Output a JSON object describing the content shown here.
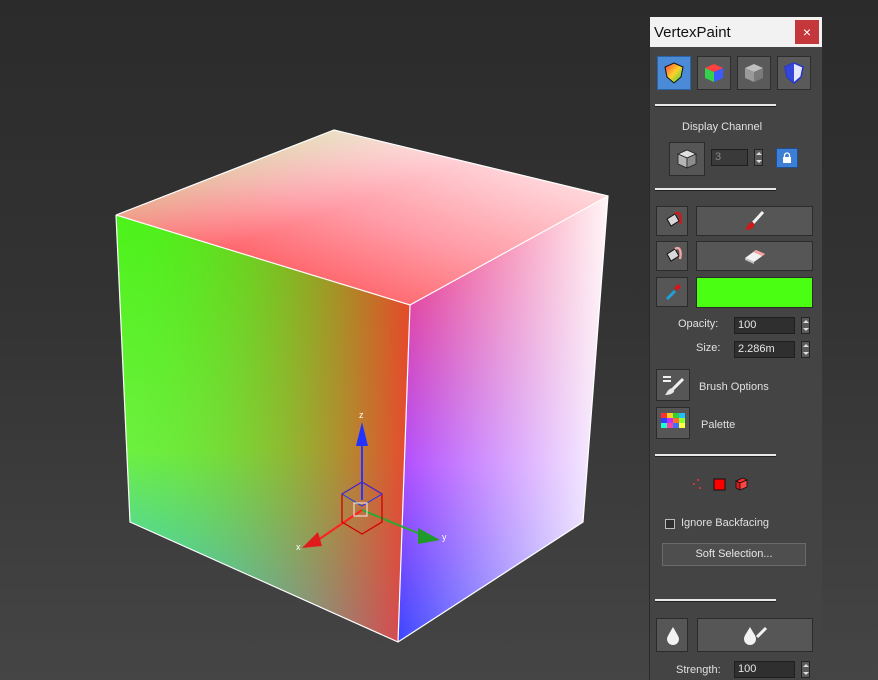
{
  "viewport": {
    "gizmo_axes": {
      "x": "x",
      "y": "y",
      "z": "z"
    }
  },
  "panel": {
    "title": "VertexPaint",
    "close_glyph": "×",
    "mode_icons": [
      "vertex-color-mode-icon",
      "vertex-color-display-icon",
      "shaded-display-icon",
      "shield-display-icon"
    ],
    "display_channel": {
      "label": "Display Channel",
      "value": "3"
    },
    "paint_buttons": {
      "paint_icon": "paintbrush-icon",
      "erase_icon": "eraser-icon",
      "pick_icon": "eyedropper-icon",
      "current_color": "#4bff13"
    },
    "opacity": {
      "label": "Opacity:",
      "value": "100"
    },
    "size": {
      "label": "Size:",
      "value": "2.286m"
    },
    "brush_options": {
      "label": "Brush Options"
    },
    "palette": {
      "label": "Palette"
    },
    "ignore_backfacing": {
      "label": "Ignore Backfacing",
      "checked": false
    },
    "soft_selection": {
      "label": "Soft Selection..."
    },
    "strength": {
      "label": "Strength:",
      "value": "100"
    }
  }
}
